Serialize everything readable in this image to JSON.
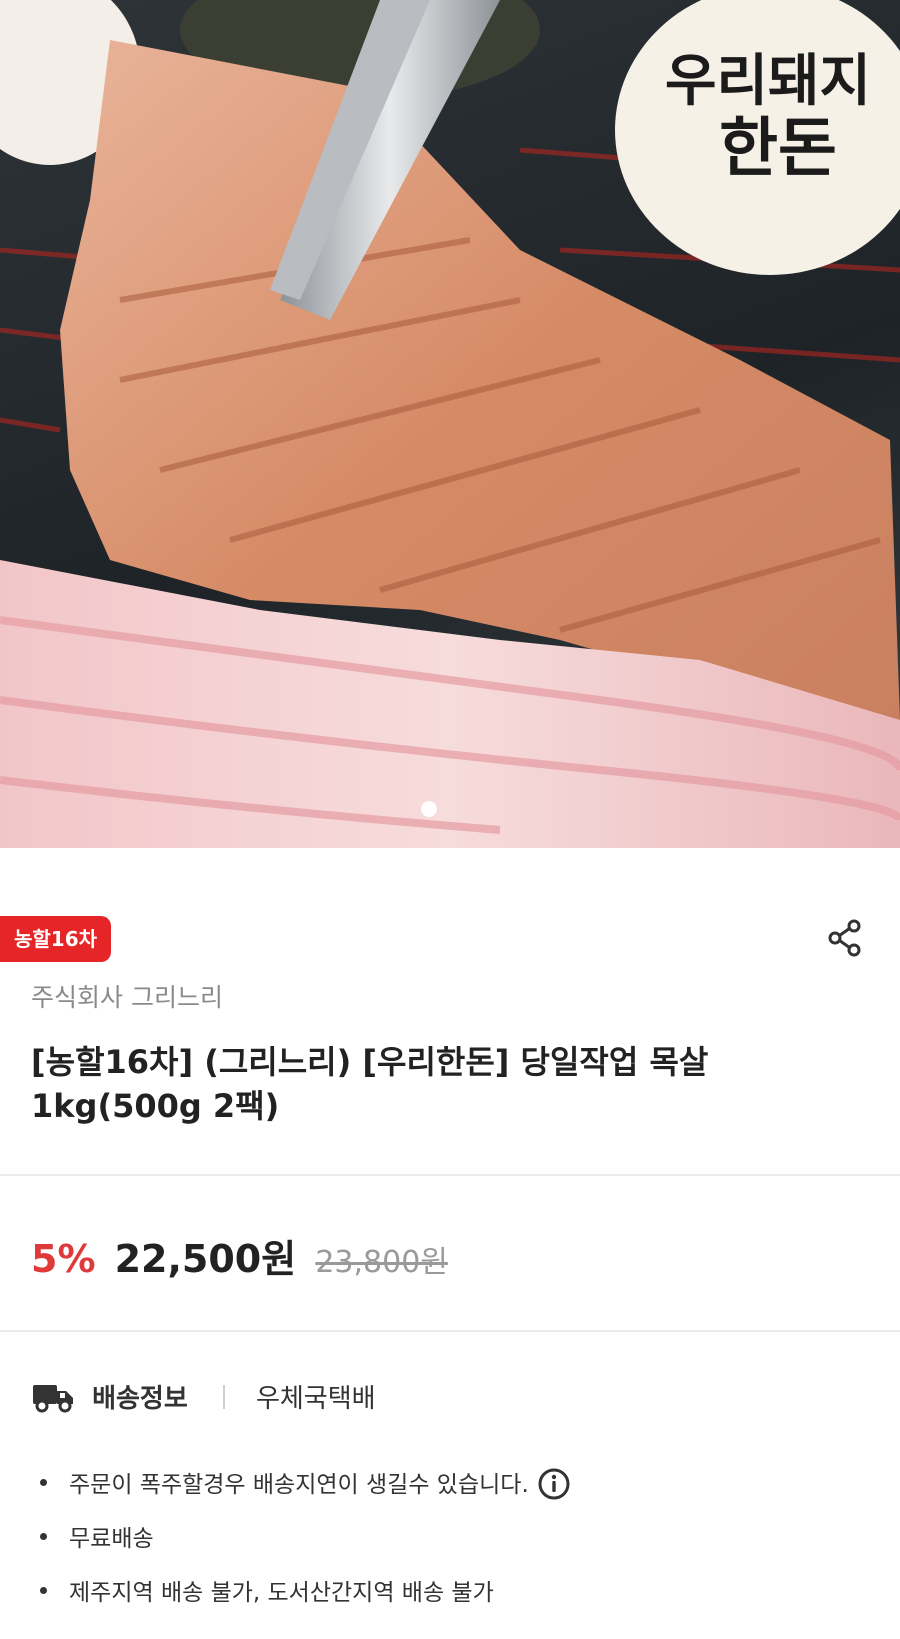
{
  "hero": {
    "logo_text": "우리돼지 한돈",
    "image_description_name": "grilled-pork-neck-photo",
    "carousel_current": 1
  },
  "badge": "농할16차",
  "seller": "주식회사 그리느리",
  "title": "[농할16차] (그리느리) [우리한돈] 당일작업 목살 1kg(500g 2팩)",
  "price": {
    "discount": "5%",
    "sale": "22,500원",
    "original": "23,800원"
  },
  "shipping": {
    "label": "배송정보",
    "method": "우체국택배",
    "notes": [
      "주문이 폭주할경우 배송지연이 생길수 있습니다.",
      "무료배송",
      "제주지역 배송 불가, 도서산간지역 배송 불가"
    ]
  },
  "colors": {
    "accent": "#e52528",
    "discount": "#e0393a"
  }
}
